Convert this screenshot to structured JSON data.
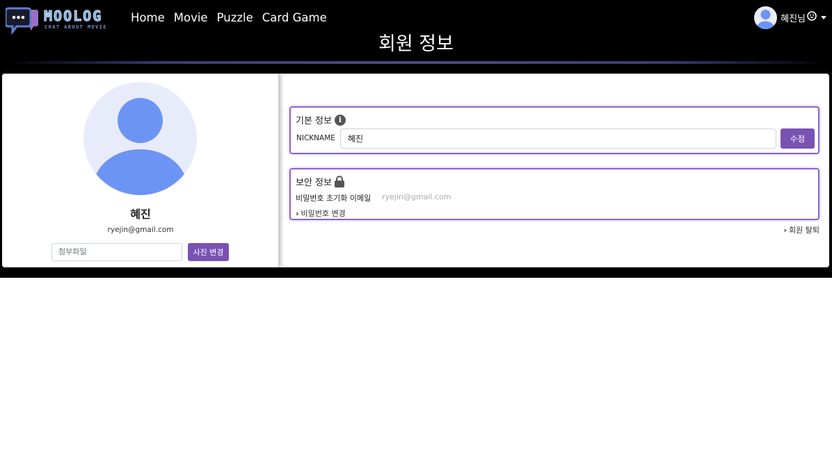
{
  "brand": {
    "logo_title": "MOOLOG",
    "logo_subtitle": "CHAT ABOUT MOVIE"
  },
  "nav": {
    "links": [
      "Home",
      "Movie",
      "Puzzle",
      "Card Game"
    ]
  },
  "user_menu": {
    "name": "혜진님",
    "icon": "smile-icon"
  },
  "page": {
    "title": "회원 정보"
  },
  "profile": {
    "name": "혜진",
    "email": "ryejin@gmail.com",
    "file_placeholder": "첨부파일",
    "change_photo_label": "사진 변경"
  },
  "basic_info": {
    "header": "기본 정보",
    "nickname_label": "NICKNAME",
    "nickname_value": "혜진",
    "edit_label": "수정"
  },
  "security_info": {
    "header": "보안 정보",
    "reset_email_label": "비밀번호 초기화 이메일",
    "reset_email_value": "ryejin@gmail.com",
    "change_password_label": "비밀번호 변경"
  },
  "withdraw_label": "회원 탈퇴",
  "colors": {
    "accent": "#7952b3",
    "avatar_fill": "#6c94f4",
    "avatar_bg": "#e8ebfa",
    "background": "#000000"
  }
}
